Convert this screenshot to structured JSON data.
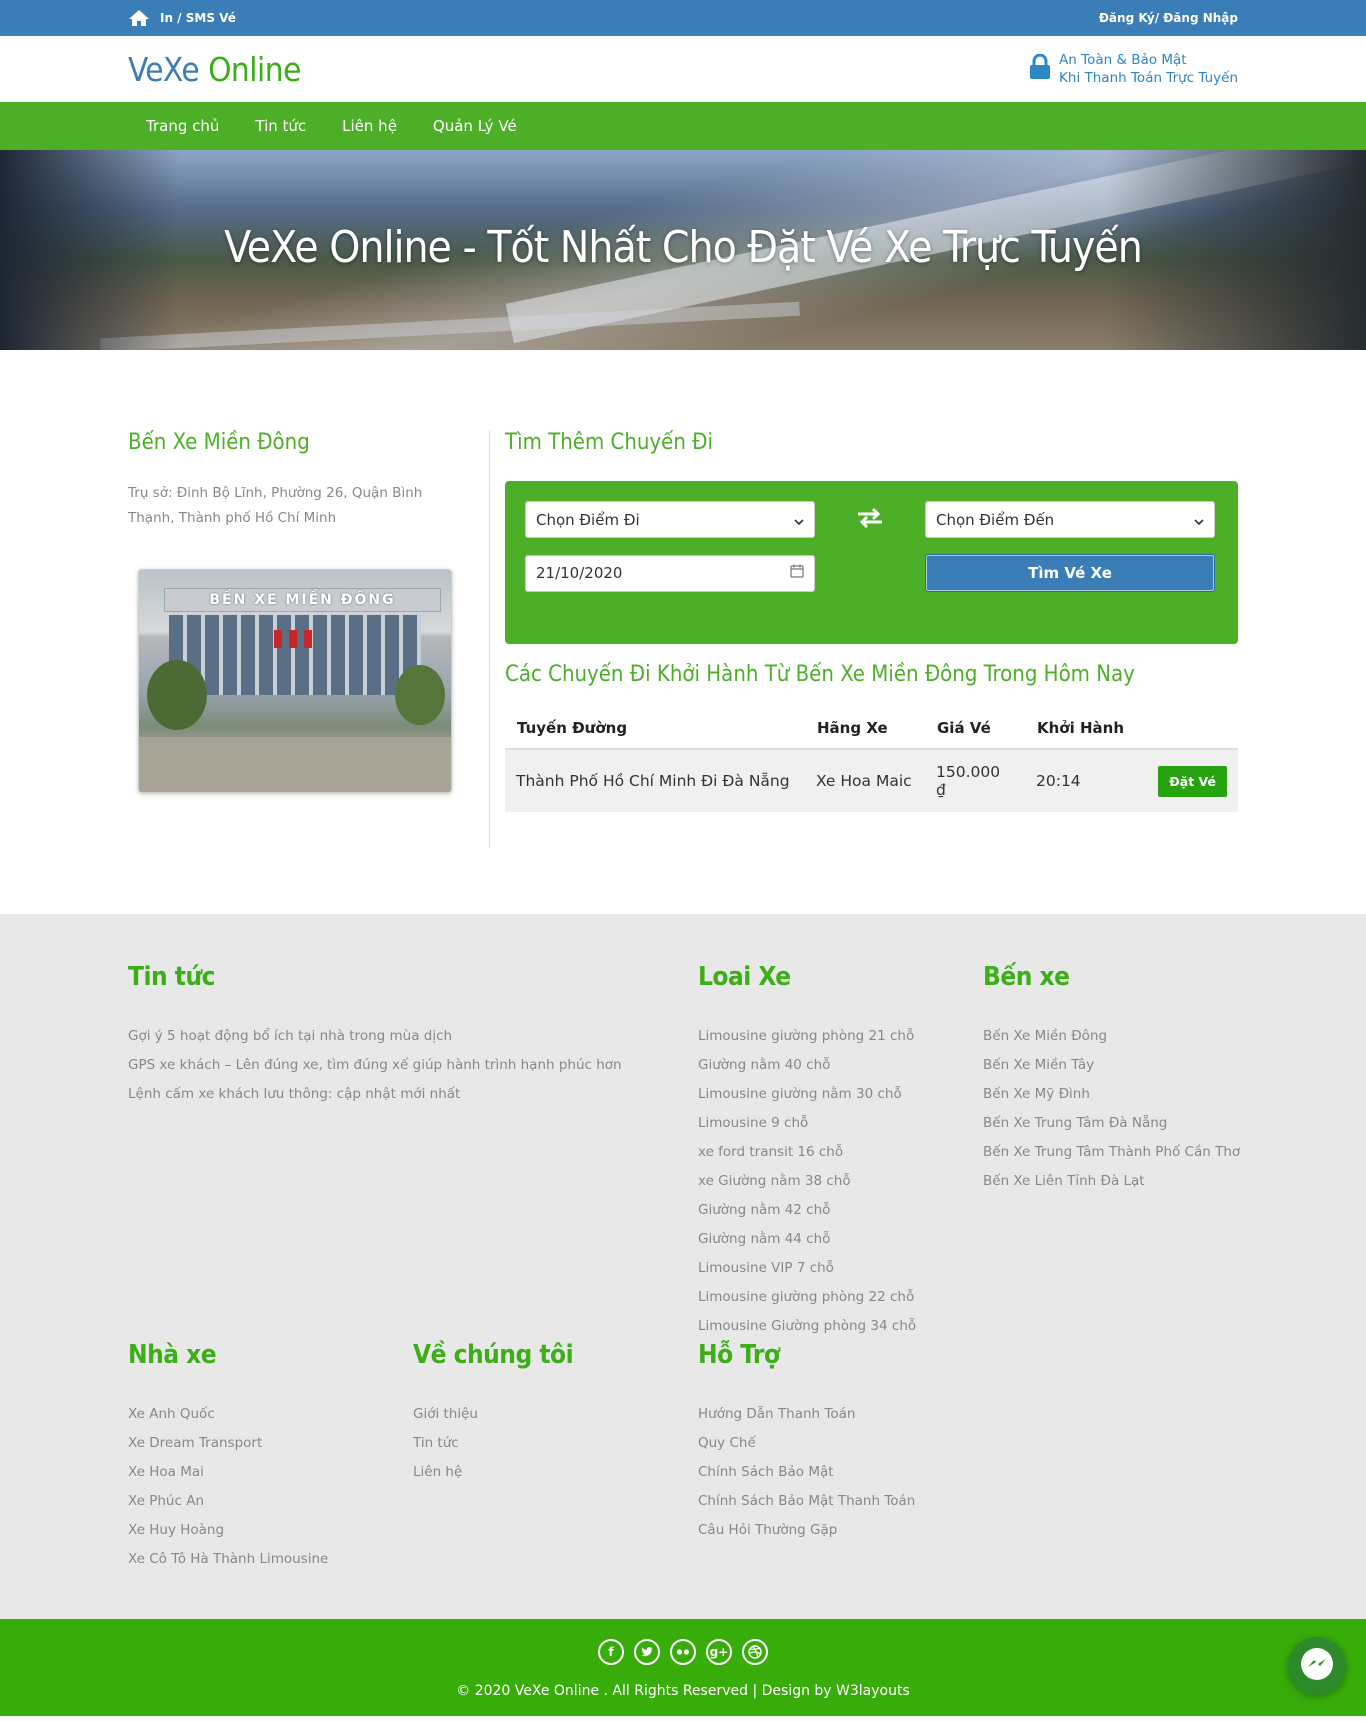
{
  "topbar": {
    "breadcrumb": "In / SMS Vé",
    "auth": "Đăng Ký/ Đăng Nhập"
  },
  "header": {
    "logo_part1": "VeXe",
    "logo_part2": " Online",
    "secure_line1": "An Toàn & Bảo Mật",
    "secure_line2": "Khi Thanh Toán Trực Tuyến"
  },
  "nav": {
    "items": [
      "Trang chủ",
      "Tin tức",
      "Liên hệ",
      "Quản Lý Vé"
    ]
  },
  "banner": {
    "title": "VeXe Online - Tốt Nhất Cho Đặt Vé Xe Trực Tuyến"
  },
  "station": {
    "name": "Bến Xe Miền Đông",
    "address": "Trụ sở: Đinh Bộ Lĩnh, Phường 26, Quận Bình Thạnh, Thành phố Hồ Chí Minh",
    "sign_text": "BẾN XE MIỀN ĐÔNG"
  },
  "search": {
    "title": "Tìm Thêm Chuyến Đi",
    "from": "Chọn Điểm Đi",
    "to": "Chọn Điểm Đến",
    "date": "21/10/2020",
    "button": "Tìm Vé Xe"
  },
  "trips": {
    "title": "Các Chuyến Đi Khởi Hành Từ Bến Xe Miền Đông Trong Hôm Nay",
    "headers": [
      "Tuyến Đường",
      "Hãng Xe",
      "Giá Vé",
      "Khởi Hành"
    ],
    "rows": [
      {
        "route": "Thành Phố Hồ Chí Minh Đi Đà Nẵng",
        "company": "Xe Hoa Maic",
        "price": "150.000 ₫",
        "time": "20:14",
        "action": "Đặt Vé"
      }
    ]
  },
  "footer": {
    "news": {
      "title": "Tin tức",
      "items": [
        "Gợi ý 5 hoạt động bổ ích tại nhà trong mùa dịch",
        "GPS xe khách – Lên đúng xe, tìm đúng xế giúp hành trình hạnh phúc hơn",
        "Lệnh cấm xe khách lưu thông: cập nhật mới nhất"
      ]
    },
    "types": {
      "title": "Loai Xe",
      "items": [
        "Limousine giường phòng 21 chỗ",
        "Giường nằm 40 chỗ",
        "Limousine giường nằm 30 chỗ",
        "Limousine 9 chỗ",
        "xe ford transit 16 chỗ",
        "xe Giường nằm 38 chỗ",
        "Giường nằm 42 chỗ",
        "Giường nằm 44 chỗ",
        "Limousine VIP 7 chỗ",
        "Limousine giường phòng 22 chỗ",
        "Limousine Giường phòng 34 chỗ"
      ]
    },
    "stations": {
      "title": "Bến xe",
      "items": [
        "Bến Xe Miền Đông",
        "Bến Xe Miền Tây",
        "Bến Xe Mỹ Đình",
        "Bến Xe Trung Tâm Đà Nẵng",
        "Bến Xe Trung Tâm Thành Phố Cần Thơ",
        "Bến Xe Liên Tỉnh Đà Lạt"
      ]
    },
    "operators": {
      "title": "Nhà xe",
      "items": [
        "Xe Anh Quốc",
        "Xe Dream Transport",
        "Xe Hoa Mai",
        "Xe Phúc An",
        "Xe Huy Hoàng",
        "Xe Cô Tô Hà Thành Limousine"
      ]
    },
    "about": {
      "title": "Về chúng tôi",
      "items": [
        "Giới thiệu",
        "Tin tức",
        "Liên hệ"
      ]
    },
    "support": {
      "title": "Hỗ Trợ",
      "items": [
        "Hướng Dẫn Thanh Toán",
        "Quy Chế",
        "Chính Sách Bảo Mật",
        "Chính Sách Bảo Mật Thanh Toán",
        "Câu Hỏi Thường Gặp"
      ]
    }
  },
  "bottom": {
    "socials": [
      "facebook-icon",
      "twitter-icon",
      "flickr-icon",
      "google-plus-icon",
      "dribbble-icon"
    ],
    "copyright": "© 2020 VeXe Online . All Rights Reserved | Design by W3layouts"
  }
}
